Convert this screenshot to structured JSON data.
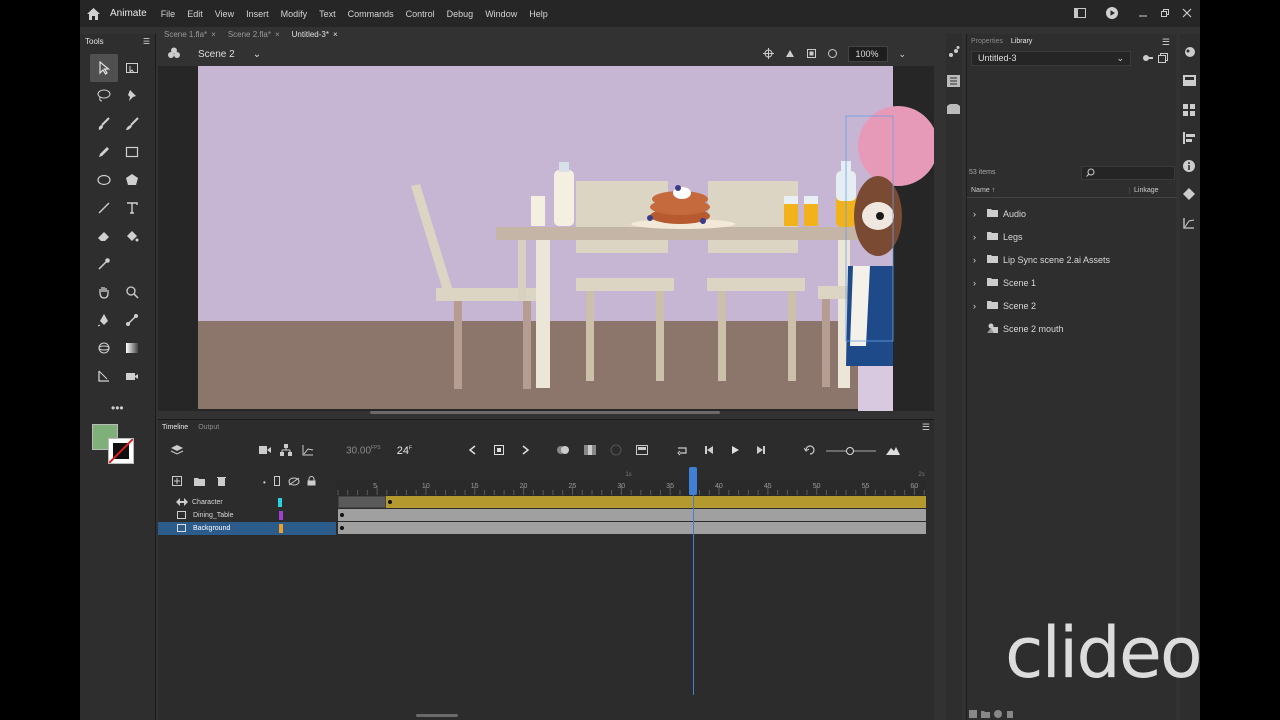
{
  "app": {
    "name": "Animate",
    "menu": [
      "File",
      "Edit",
      "View",
      "Insert",
      "Modify",
      "Text",
      "Commands",
      "Control",
      "Debug",
      "Window",
      "Help"
    ]
  },
  "doc_tabs": [
    {
      "label": "Scene 1.fla*",
      "active": false
    },
    {
      "label": "Scene 2.fla*",
      "active": false
    },
    {
      "label": "Untitled-3*",
      "active": true
    }
  ],
  "tools_panel": {
    "title": "Tools"
  },
  "stage": {
    "scene": "Scene 2",
    "zoom": "100%"
  },
  "timeline": {
    "tabs": [
      "Timeline",
      "Output"
    ],
    "fps": "30.00",
    "fps_unit": "FPS",
    "frame": "24",
    "frame_unit": "F",
    "ruler_ticks": [
      "5",
      "10",
      "15",
      "20",
      "25",
      "30",
      "35",
      "40",
      "45",
      "50",
      "55",
      "60"
    ],
    "time_marks": [
      "1s",
      "2s"
    ],
    "layers": [
      {
        "name": "Character",
        "color": "#28d0e0",
        "selected": false
      },
      {
        "name": "Dining_Table",
        "color": "#a040d0",
        "selected": false
      },
      {
        "name": "Background",
        "color": "#f0a020",
        "selected": true
      }
    ],
    "playhead_frame": 30
  },
  "library": {
    "tabs": [
      "Properties",
      "Library"
    ],
    "active_tab": "Library",
    "document": "Untitled-3",
    "count": "53 items",
    "col_name": "Name",
    "col_linkage": "Linkage",
    "items": [
      {
        "name": "Audio",
        "type": "folder"
      },
      {
        "name": "Legs",
        "type": "folder"
      },
      {
        "name": "Lip Sync scene 2.ai Assets",
        "type": "folder"
      },
      {
        "name": "Scene 1",
        "type": "folder"
      },
      {
        "name": "Scene 2",
        "type": "folder"
      },
      {
        "name": "Scene 2 mouth",
        "type": "symbol"
      }
    ]
  },
  "watermark": "clideo.com",
  "colors": {
    "stroke_swatch": "#000000",
    "fill_swatch": "#7fb07a",
    "stage_wall": "#c6b6d4",
    "stage_floor": "#8c766c",
    "selection_blue": "#2c5c8c"
  }
}
